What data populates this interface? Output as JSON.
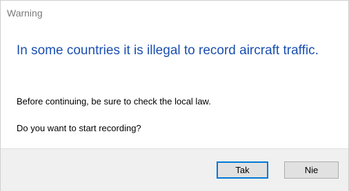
{
  "dialog": {
    "title": "Warning",
    "main_instruction": "In some countries it is illegal to record aircraft traffic.",
    "content_line_1": "Before continuing, be sure to check the local law.",
    "content_line_2": "Do you want to start recording?"
  },
  "buttons": {
    "yes_label": "Tak",
    "no_label": "Nie",
    "default": "Tak"
  },
  "colors": {
    "instruction_text": "#1a4fb0",
    "default_button_border": "#0078d7",
    "button_area_background": "#f0f0f0"
  }
}
